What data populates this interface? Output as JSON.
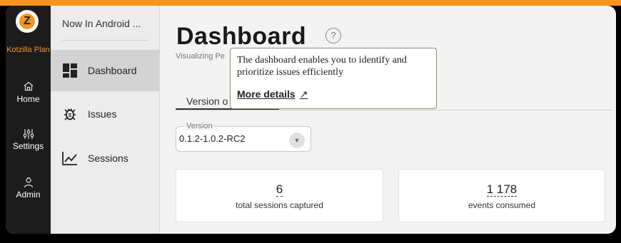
{
  "app": {
    "brand_name": "Kotzilla Plan",
    "logo_glyph": "Z",
    "accent_color": "#f7941d"
  },
  "rail": {
    "items": [
      {
        "label": "Home",
        "icon": "home-icon"
      },
      {
        "label": "Settings",
        "icon": "sliders-icon"
      },
      {
        "label": "Admin",
        "icon": "admin-icon"
      }
    ]
  },
  "nav": {
    "project_title": "Now In Android ...",
    "items": [
      {
        "label": "Dashboard",
        "icon": "dashboard-icon",
        "active": true
      },
      {
        "label": "Issues",
        "icon": "bug-icon",
        "active": false
      },
      {
        "label": "Sessions",
        "icon": "chart-line-icon",
        "active": false
      }
    ]
  },
  "main": {
    "title": "Dashboard",
    "subtitle": "Visualizing Pe",
    "tab_label": "Version o",
    "version_select": {
      "label": "Version",
      "value": "0.1.2-1.0.2-RC2"
    },
    "cards": [
      {
        "value": "6",
        "label": "total sessions captured"
      },
      {
        "value": "1 178",
        "label": "events consumed"
      }
    ]
  },
  "tooltip": {
    "text": "The dashboard enables you to identify and prioritize issues efficiently",
    "link_label": "More details"
  }
}
